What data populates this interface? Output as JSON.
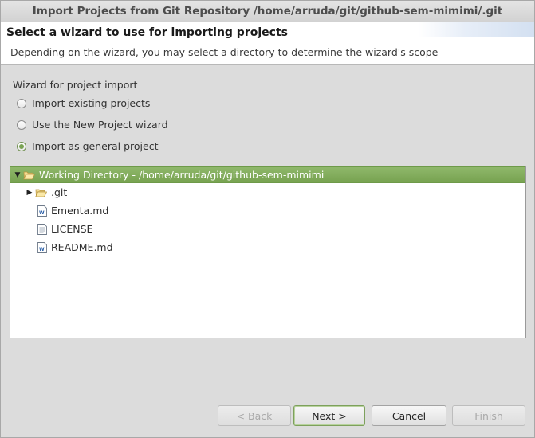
{
  "window": {
    "title": "Import Projects from Git Repository /home/arruda/git/github-sem-mimimi/.git"
  },
  "header": {
    "title": "Select a wizard to use for importing projects",
    "description": "Depending on the wizard, you may select a directory to determine the wizard's scope"
  },
  "wizard_group": {
    "label": "Wizard for project import",
    "options": [
      {
        "label": "Import existing projects",
        "checked": false
      },
      {
        "label": "Use the New Project wizard",
        "checked": false
      },
      {
        "label": "Import as general project",
        "checked": true
      }
    ]
  },
  "tree": {
    "root": {
      "label": "Working Directory - /home/arruda/git/github-sem-mimimi",
      "expanded": true,
      "selected": true,
      "icon": "open-folder-icon"
    },
    "children": [
      {
        "label": ".git",
        "icon": "folder-icon",
        "expandable": true
      },
      {
        "label": "Ementa.md",
        "icon": "markdown-file-icon"
      },
      {
        "label": "LICENSE",
        "icon": "text-file-icon"
      },
      {
        "label": "README.md",
        "icon": "markdown-file-icon"
      }
    ]
  },
  "buttons": {
    "back": "< Back",
    "next": "Next >",
    "cancel": "Cancel",
    "finish": "Finish"
  },
  "colors": {
    "selection": "#7aa354",
    "accent_border": "#7da05c"
  }
}
